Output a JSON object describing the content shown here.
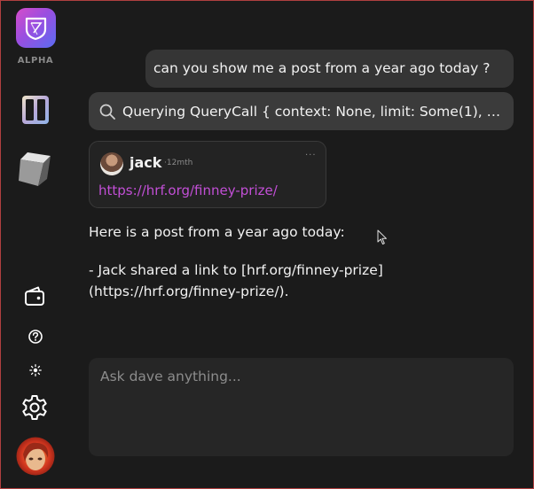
{
  "sidebar": {
    "app_badge": "ALPHA",
    "items": [
      {
        "name": "panels-icon"
      },
      {
        "name": "cube-icon"
      },
      {
        "name": "wallet-icon"
      },
      {
        "name": "help-icon"
      },
      {
        "name": "sun-icon"
      },
      {
        "name": "gear-icon"
      },
      {
        "name": "user-avatar"
      }
    ]
  },
  "chat": {
    "user_message": "can you show me a post from a year ago today ?",
    "tool_call": "Querying QueryCall { context: None, limit: Some(1), s...",
    "post": {
      "author": "jack",
      "time": "·12mth",
      "menu": "···",
      "link": "https://hrf.org/finney-prize/"
    },
    "response_line1": "Here is a post from a year ago today:",
    "response_line2": "- Jack shared a link to [hrf.org/finney-prize](https://hrf.org/finney-prize/)."
  },
  "input": {
    "placeholder": "Ask dave anything...",
    "value": ""
  },
  "colors": {
    "background": "#1b1b1b",
    "bubble": "#353535",
    "link": "#c24fd6",
    "accent_gradient_start": "#d64cc9",
    "accent_gradient_end": "#5a6cf2"
  }
}
